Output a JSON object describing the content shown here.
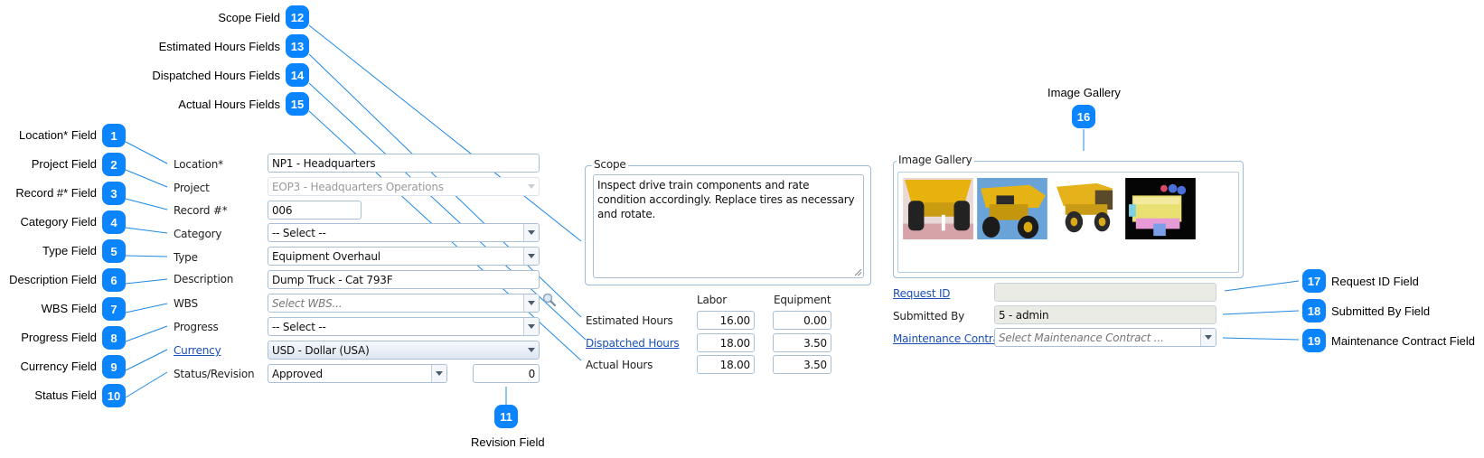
{
  "callouts": [
    {
      "n": "1",
      "label": "Location* Field"
    },
    {
      "n": "2",
      "label": "Project Field"
    },
    {
      "n": "3",
      "label": "Record #* Field"
    },
    {
      "n": "4",
      "label": "Category Field"
    },
    {
      "n": "5",
      "label": "Type Field"
    },
    {
      "n": "6",
      "label": "Description Field"
    },
    {
      "n": "7",
      "label": "WBS Field"
    },
    {
      "n": "8",
      "label": "Progress Field"
    },
    {
      "n": "9",
      "label": "Currency Field"
    },
    {
      "n": "10",
      "label": "Status Field"
    },
    {
      "n": "11",
      "label": "Revision Field"
    },
    {
      "n": "12",
      "label": "Scope Field"
    },
    {
      "n": "13",
      "label": "Estimated Hours Fields"
    },
    {
      "n": "14",
      "label": "Dispatched Hours Fields"
    },
    {
      "n": "15",
      "label": "Actual Hours Fields"
    },
    {
      "n": "16",
      "label": "Image Gallery"
    },
    {
      "n": "17",
      "label": "Request ID Field"
    },
    {
      "n": "18",
      "label": "Submitted By Field"
    },
    {
      "n": "19",
      "label": "Maintenance Contract Field"
    }
  ],
  "form": {
    "location": {
      "label": "Location*",
      "value": "NP1 - Headquarters"
    },
    "project": {
      "label": "Project",
      "value": "EOP3 - Headquarters Operations"
    },
    "record": {
      "label": "Record #*",
      "value": "006"
    },
    "category": {
      "label": "Category",
      "value": "-- Select --"
    },
    "type": {
      "label": "Type",
      "value": "Equipment Overhaul"
    },
    "description": {
      "label": "Description",
      "value": "Dump Truck - Cat 793F"
    },
    "wbs": {
      "label": "WBS",
      "placeholder": "Select WBS..."
    },
    "progress": {
      "label": "Progress",
      "value": "-- Select --"
    },
    "currency": {
      "label": "Currency",
      "value": "USD - Dollar (USA)"
    },
    "status": {
      "label": "Status/Revision",
      "value": "Approved",
      "revision": "0"
    }
  },
  "scope": {
    "legend": "Scope",
    "text": "Inspect drive train components and rate condition accordingly. Replace tires as necessary and rotate."
  },
  "hours": {
    "col_labor": "Labor",
    "col_equipment": "Equipment",
    "rows": [
      {
        "label": "Estimated Hours",
        "labor": "16.00",
        "equipment": "0.00"
      },
      {
        "label": "Dispatched Hours",
        "labor": "18.00",
        "equipment": "3.50"
      },
      {
        "label": "Actual Hours",
        "labor": "18.00",
        "equipment": "3.50"
      }
    ]
  },
  "gallery": {
    "legend": "Image Gallery",
    "images": [
      "dump-truck-rear",
      "dump-truck-front",
      "dump-truck-side",
      "engine-cutaway"
    ]
  },
  "right": {
    "request_id": {
      "label": "Request ID",
      "value": ""
    },
    "submitted_by": {
      "label": "Submitted By",
      "value": "5 - admin"
    },
    "maintenance_contract": {
      "label": "Maintenance Contract",
      "placeholder": "Select Maintenance Contract ..."
    }
  },
  "colors": {
    "badge": "#0a84ff",
    "link": "#1a4fb8",
    "leader_line": "#1e88e5"
  }
}
